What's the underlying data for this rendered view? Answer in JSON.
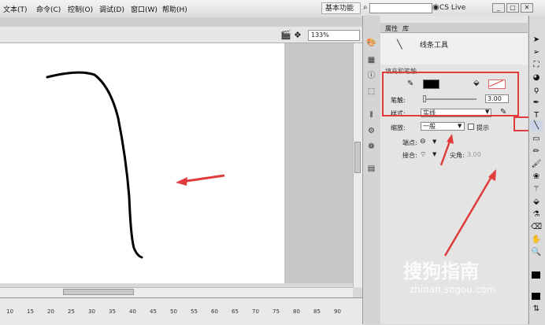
{
  "menubar": {
    "items": [
      "文本(T)",
      "命令(C)",
      "控制(O)",
      "调试(D)",
      "窗口(W)",
      "帮助(H)"
    ],
    "workspace": "基本功能",
    "cslive": "CS Live",
    "win_min": "_",
    "win_max": "▢",
    "win_close": "✕"
  },
  "edit_bar": {
    "zoom": "133%"
  },
  "ruler": {
    "ticks": [
      "10",
      "15",
      "20",
      "25",
      "30",
      "35",
      "40",
      "45",
      "50",
      "55",
      "60",
      "65",
      "70",
      "75",
      "80",
      "85",
      "90"
    ]
  },
  "props": {
    "tabs": [
      "属性",
      "库"
    ],
    "tool_name": "线条工具",
    "section": "填充和笔触",
    "stroke_label": "笔触:",
    "stroke_value": "3.00",
    "style_label": "样式:",
    "style_value": "实线",
    "scale_label": "缩放:",
    "scale_value": "一般",
    "hint_label": "提示",
    "cap_label": "端点:",
    "join_label": "接合:",
    "miter_label": "尖角:",
    "miter_value": "3.00"
  },
  "watermark": {
    "text": "搜狗指南",
    "url": "zhinan.sogou.com"
  },
  "colors": {
    "annotation": "#e03c3c",
    "stroke": "#000000"
  }
}
